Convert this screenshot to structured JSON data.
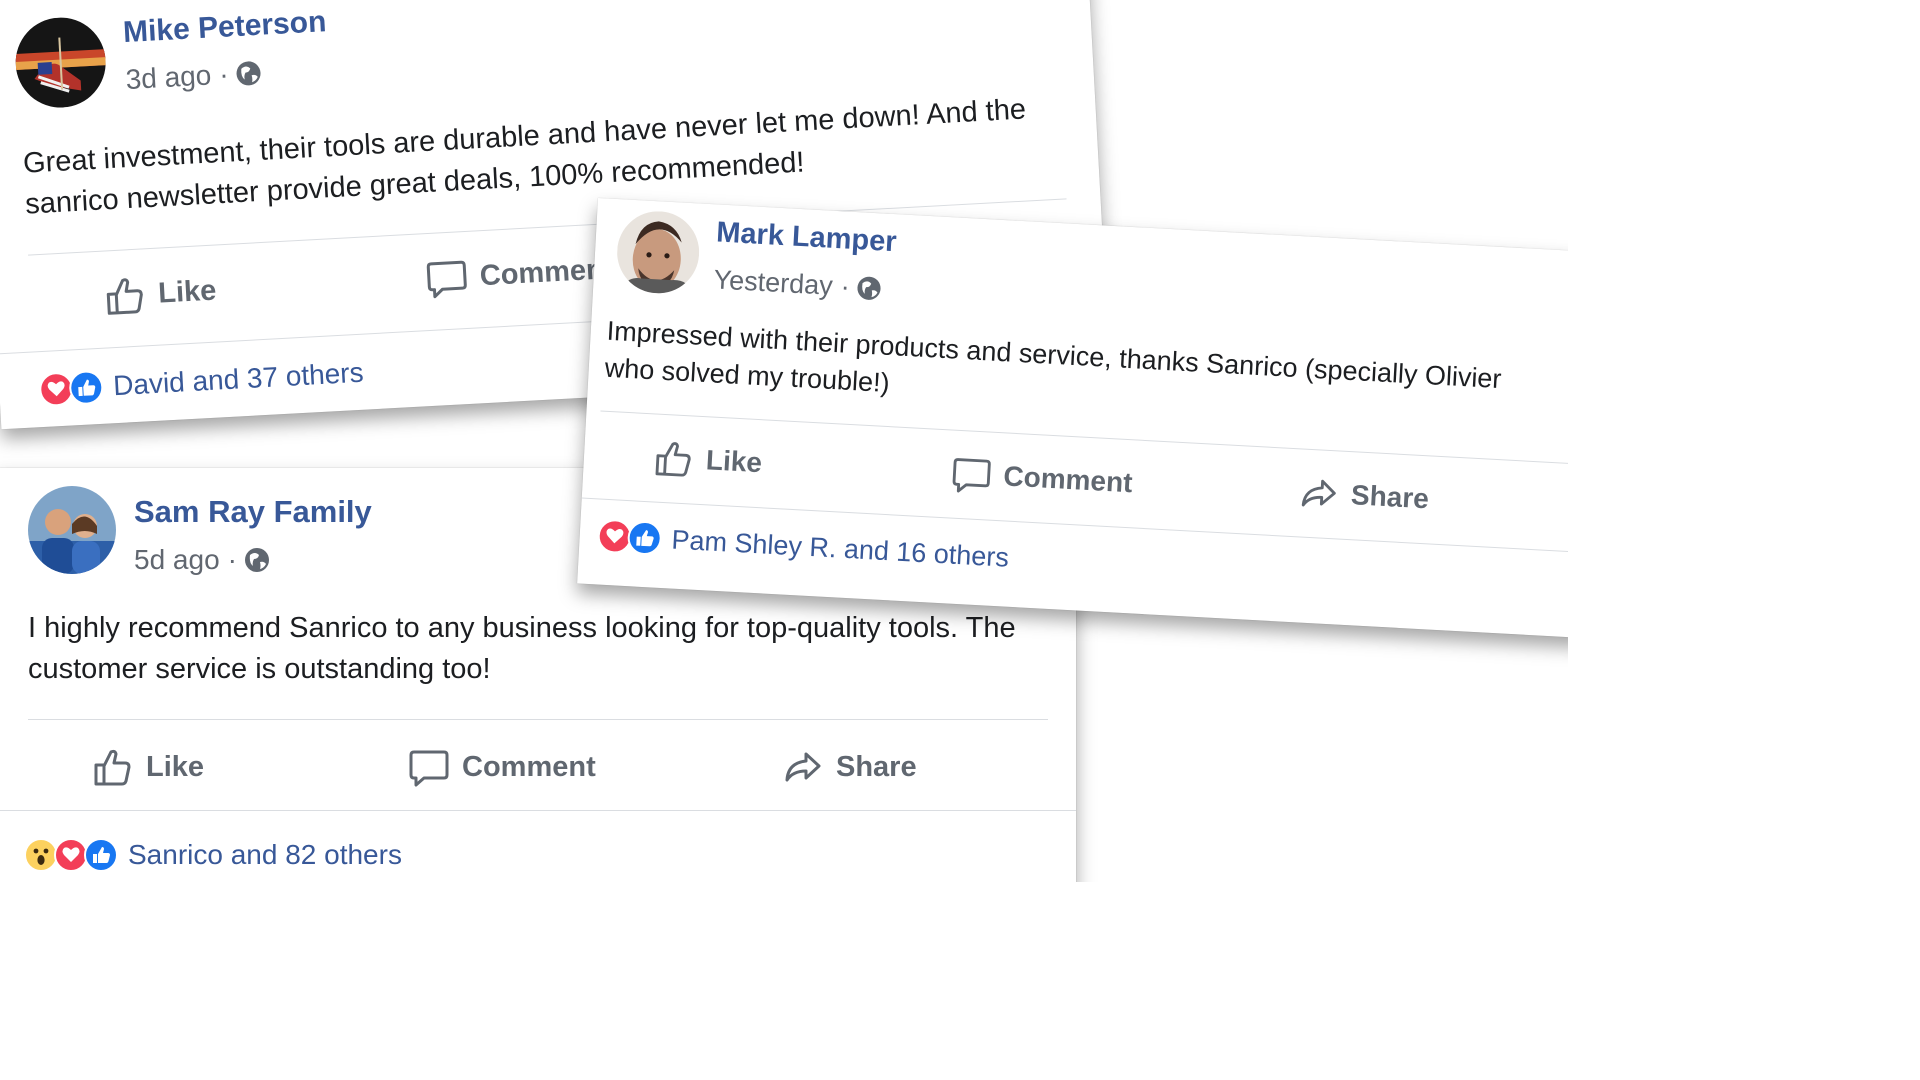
{
  "colors": {
    "name_blue": "#385898",
    "meta_gray": "#616770",
    "action_gray": "#606770",
    "heart_red": "#f33e58",
    "like_blue": "#1877f2",
    "wow_yellow": "#fcd15f"
  },
  "posts": [
    {
      "author": "Mike Peterson",
      "time": "3d ago",
      "privacy_icon": "globe-icon",
      "text": "Great investment, their tools are durable and have never let me down! And the sanrico newsletter provide great deals, 100% recommended!",
      "actions": {
        "like": "Like",
        "comment": "Comment"
      },
      "reactions": [
        "heart",
        "like"
      ],
      "reaction_summary": "David and 37 others"
    },
    {
      "author": "Mark Lamper",
      "time": "Yesterday",
      "privacy_icon": "globe-icon",
      "text": "Impressed with their products and service, thanks Sanrico (specially Olivier who solved my trouble!)",
      "actions": {
        "like": "Like",
        "comment": "Comment",
        "share": "Share"
      },
      "reactions": [
        "heart",
        "like"
      ],
      "reaction_summary": "Pam Shley R. and 16 others"
    },
    {
      "author": "Sam Ray Family",
      "time": "5d ago",
      "privacy_icon": "globe-icon",
      "text": "I highly recommend Sanrico to any business looking for top-quality tools. The customer service is outstanding too!",
      "actions": {
        "like": "Like",
        "comment": "Comment",
        "share": "Share"
      },
      "reactions": [
        "wow",
        "heart",
        "like"
      ],
      "reaction_summary": "Sanrico and 82 others"
    }
  ]
}
